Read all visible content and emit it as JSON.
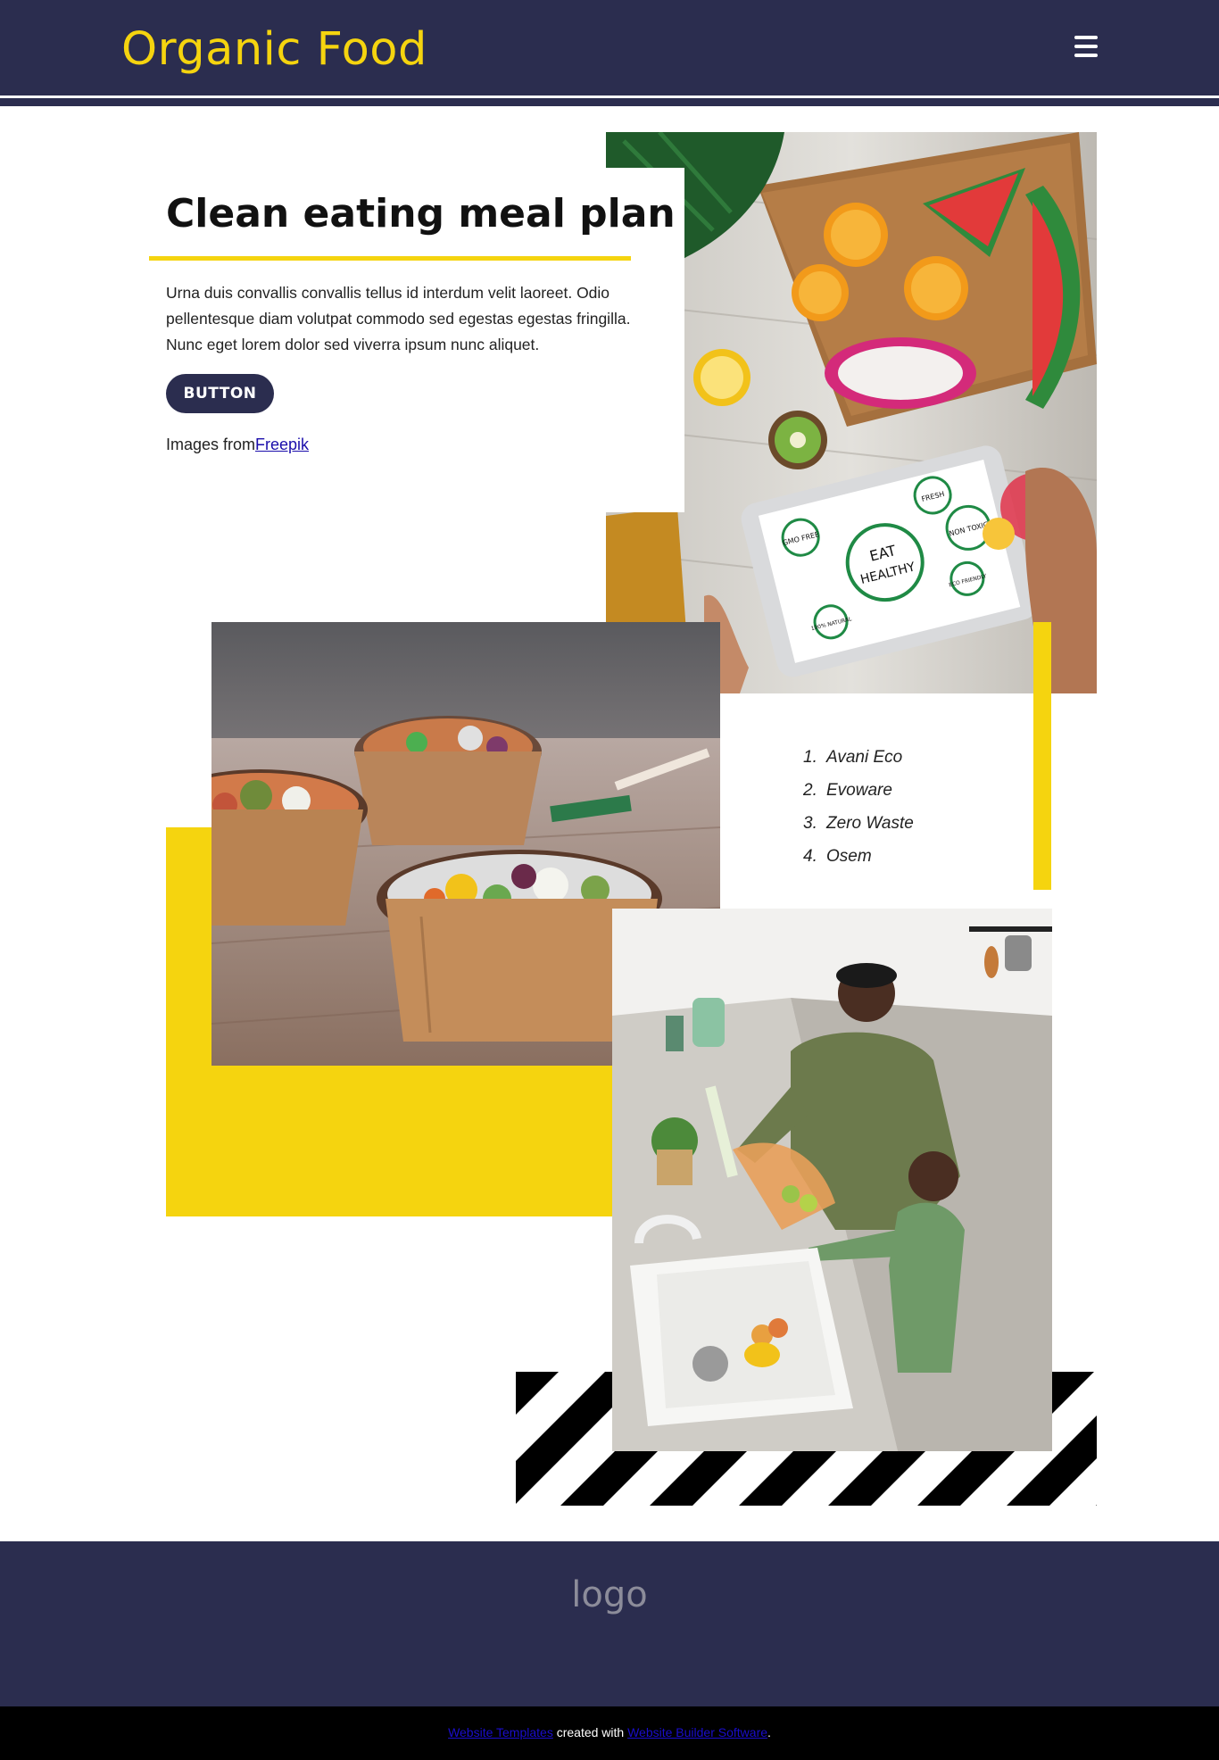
{
  "header": {
    "site_title": "Organic Food",
    "menu_icon": "hamburger-icon",
    "background": "#2b2d4f",
    "title_color": "#f5d40f"
  },
  "hero": {
    "heading": "Clean eating meal plan",
    "paragraph": "Urna duis convallis convallis tellus id interdum velit laoreet. Odio pellentesque diam volutpat commodo sed egestas egestas fringilla. Nunc eget lorem dolor sed viverra ipsum nunc aliquet.",
    "button_label": "BUTTON",
    "credit_prefix": "Images from",
    "credit_link": "Freepik"
  },
  "brands": {
    "items": [
      {
        "number": "1.",
        "label": "Avani Eco"
      },
      {
        "number": "2.",
        "label": "Evoware"
      },
      {
        "number": "3.",
        "label": "Zero Waste"
      },
      {
        "number": "4.",
        "label": "Osem"
      }
    ]
  },
  "images": {
    "photo_fruits_tablet": {
      "tablet_text_1": "EAT",
      "tablet_text_2": "HEALTHY",
      "tag_1": "GMO FREE",
      "tag_2": "FRESH",
      "tag_3": "NON TOXIC",
      "tag_4": "ECO FRIENDLY",
      "tag_5": "100% NATURAL"
    }
  },
  "footer": {
    "logo_text": "logo",
    "bottom_link_1": "Website Templates",
    "bottom_middle": " created with ",
    "bottom_link_2": "Website Builder Software",
    "bottom_end": "."
  },
  "colors": {
    "accent": "#f5d40f",
    "navy": "#2b2d4f",
    "bottom_bar": "#000000"
  }
}
